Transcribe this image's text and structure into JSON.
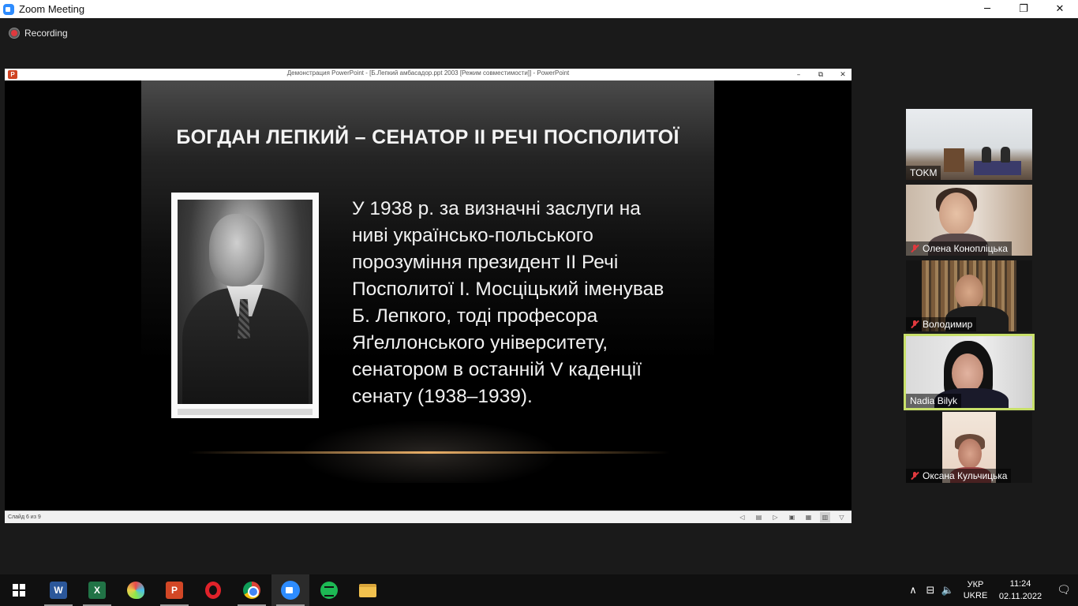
{
  "zoom_window": {
    "title": "Zoom Meeting",
    "controls": {
      "minimize": "─",
      "restore": "❐",
      "close": "✕"
    }
  },
  "recording": {
    "label": "Recording",
    "color": "#e0393e"
  },
  "shared_window": {
    "title": "Демонстрация PowerPoint - [Б.Лепкий амбасадор.ppt 2003 [Режим совместимости]] - PowerPoint",
    "app_icon_label": "P",
    "controls": {
      "minimize": "–",
      "restore": "⧉",
      "close": "✕"
    },
    "status": {
      "slide_counter": "Слайд 6 из 9",
      "icons": [
        "◁",
        "▤",
        "▷",
        "▣",
        "▦",
        "▥",
        "▽"
      ]
    }
  },
  "slide": {
    "title": "БОГДАН ЛЕПКИЙ – СЕНАТОР ІІ РЕЧІ ПОСПОЛИТОЇ",
    "text_lines": [
      "У 1938 р. за визначні заслуги на",
      "ниві українсько-польського",
      "порозуміння президент ІІ Речі",
      "Посполитої І. Мосціцький іменував",
      "Б. Лепкого, тоді професора",
      "Яґеллонського університету,",
      "сенатором в останній V каденції",
      "сенату (1938–1939)."
    ]
  },
  "participants": [
    {
      "name": "TOKM",
      "muted": false,
      "active_speaker": false
    },
    {
      "name": "Олена Коноплiцька",
      "muted": true,
      "active_speaker": false
    },
    {
      "name": "Володимир",
      "muted": true,
      "active_speaker": false
    },
    {
      "name": "Nadia Bilyk",
      "muted": false,
      "active_speaker": true
    },
    {
      "name": "Оксана Кульчицька",
      "muted": true,
      "active_speaker": false
    }
  ],
  "active_speaker_color": "#c8e06a",
  "taskbar": {
    "apps": [
      {
        "name": "Word",
        "glyph": "W",
        "color": "#2b579a"
      },
      {
        "name": "Excel",
        "glyph": "X",
        "color": "#217346"
      },
      {
        "name": "Paint",
        "glyph": ""
      },
      {
        "name": "PowerPoint",
        "glyph": "P",
        "color": "#d24726"
      },
      {
        "name": "Opera",
        "glyph": ""
      },
      {
        "name": "Chrome",
        "glyph": ""
      },
      {
        "name": "Zoom",
        "glyph": ""
      },
      {
        "name": "Spotify",
        "glyph": ""
      },
      {
        "name": "File Explorer",
        "glyph": ""
      }
    ],
    "tray": {
      "chevron": "∧",
      "network": "⊟",
      "volume": "🔈",
      "lang_top": "УКР",
      "lang_bottom": "UKRE",
      "time": "11:24",
      "date": "02.11.2022",
      "notifications": "🗨"
    }
  }
}
